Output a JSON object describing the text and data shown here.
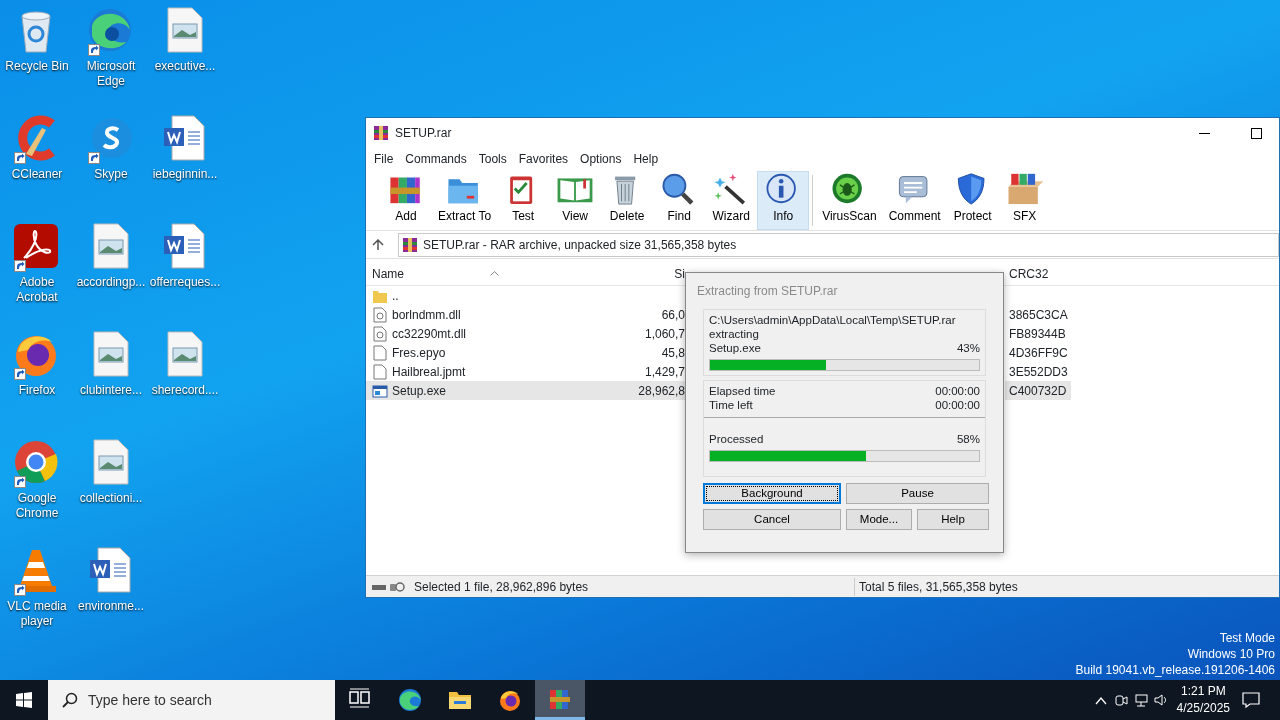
{
  "desktop": {
    "columns": [
      [
        {
          "label": "Recycle Bin",
          "kind": "recycle",
          "shortcut": false
        },
        {
          "label": "CCleaner",
          "kind": "ccleaner",
          "shortcut": true
        },
        {
          "label": "Adobe Acrobat",
          "kind": "acrobat",
          "shortcut": true
        },
        {
          "label": "Firefox",
          "kind": "firefox",
          "shortcut": true
        },
        {
          "label": "Google Chrome",
          "kind": "chrome",
          "shortcut": true
        },
        {
          "label": "VLC media player",
          "kind": "vlc",
          "shortcut": true
        }
      ],
      [
        {
          "label": "Microsoft Edge",
          "kind": "edge",
          "shortcut": true
        },
        {
          "label": "Skype",
          "kind": "skype",
          "shortcut": true
        },
        {
          "label": "accordingp...",
          "kind": "image",
          "shortcut": false
        },
        {
          "label": "clubintere...",
          "kind": "image",
          "shortcut": false
        },
        {
          "label": "collectioni...",
          "kind": "image",
          "shortcut": false
        },
        {
          "label": "environme...",
          "kind": "word",
          "shortcut": false
        }
      ],
      [
        {
          "label": "executive...",
          "kind": "image",
          "shortcut": false
        },
        {
          "label": "iebeginnin...",
          "kind": "word",
          "shortcut": false
        },
        {
          "label": "offerreques...",
          "kind": "word",
          "shortcut": false
        },
        {
          "label": "sherecord....",
          "kind": "image",
          "shortcut": false
        }
      ]
    ]
  },
  "window": {
    "title": "SETUP.rar",
    "menu": [
      "File",
      "Commands",
      "Tools",
      "Favorites",
      "Options",
      "Help"
    ],
    "toolbar": [
      {
        "label": "Add",
        "kind": "add",
        "selected": false
      },
      {
        "label": "Extract To",
        "kind": "extract",
        "selected": false
      },
      {
        "label": "Test",
        "kind": "test",
        "selected": false
      },
      {
        "label": "View",
        "kind": "view",
        "selected": false
      },
      {
        "label": "Delete",
        "kind": "delete",
        "selected": false
      },
      {
        "label": "Find",
        "kind": "find",
        "selected": false
      },
      {
        "label": "Wizard",
        "kind": "wizard",
        "selected": false
      },
      {
        "label": "Info",
        "kind": "info",
        "selected": true
      },
      {
        "label": "VirusScan",
        "kind": "virus",
        "selected": false
      },
      {
        "label": "Comment",
        "kind": "comment",
        "selected": false
      },
      {
        "label": "Protect",
        "kind": "protect",
        "selected": false
      },
      {
        "label": "SFX",
        "kind": "sfx",
        "selected": false
      }
    ],
    "address": "SETUP.rar - RAR archive, unpacked size 31,565,358 bytes",
    "table": {
      "columns": [
        "Name",
        "Si",
        "CRC32"
      ],
      "rows": [
        {
          "name": "..",
          "kind": "folder",
          "selected": false
        },
        {
          "name": "borlndmm.dll",
          "kind": "dll",
          "size": "66,0",
          "crc": "3865C3CA",
          "selected": false
        },
        {
          "name": "cc32290mt.dll",
          "kind": "dll",
          "size": "1,060,7",
          "crc": "FB89344B",
          "selected": false
        },
        {
          "name": "Fres.epyo",
          "kind": "file",
          "size": "45,8",
          "crc": "4D36FF9C",
          "selected": false
        },
        {
          "name": "Hailbreal.jpmt",
          "kind": "file",
          "size": "1,429,7",
          "crc": "3E552DD3",
          "selected": false
        },
        {
          "name": "Setup.exe",
          "kind": "exe",
          "size": "28,962,8",
          "crc": "C400732D",
          "selected": true
        }
      ]
    },
    "status_left": "Selected 1 file, 28,962,896 bytes",
    "status_right": "Total 5 files, 31,565,358 bytes"
  },
  "dialog": {
    "title": "Extracting from SETUP.rar",
    "path": "C:\\Users\\admin\\AppData\\Local\\Temp\\SETUP.rar",
    "action": "extracting",
    "file": "Setup.exe",
    "file_percent": "43%",
    "file_progress": {
      "level": 0.43
    },
    "elapsed_label": "Elapsed time",
    "elapsed": "00:00:00",
    "left_label": "Time left",
    "left": "00:00:00",
    "processed_label": "Processed",
    "processed_percent": "58%",
    "processed_progress": {
      "level": 0.58
    },
    "buttons": [
      {
        "label": "Background",
        "focused": true
      },
      {
        "label": "Pause",
        "focused": false
      },
      {
        "label": "Cancel",
        "focused": false
      },
      {
        "label": "Mode...",
        "focused": false
      },
      {
        "label": "Help",
        "focused": false
      }
    ]
  },
  "watermark_os": [
    "Test Mode",
    "Windows 10 Pro",
    "Build 19041.vb_release.191206-1406"
  ],
  "taskbar": {
    "search": {
      "placeholder": "Type here to search"
    },
    "apps": [
      {
        "kind": "taskview",
        "active": false
      },
      {
        "kind": "edge",
        "active": false
      },
      {
        "kind": "explorer",
        "active": false
      },
      {
        "kind": "firefox",
        "active": false
      },
      {
        "kind": "winrar",
        "active": true
      }
    ],
    "time": "1:21 PM",
    "date": "4/25/2025"
  }
}
